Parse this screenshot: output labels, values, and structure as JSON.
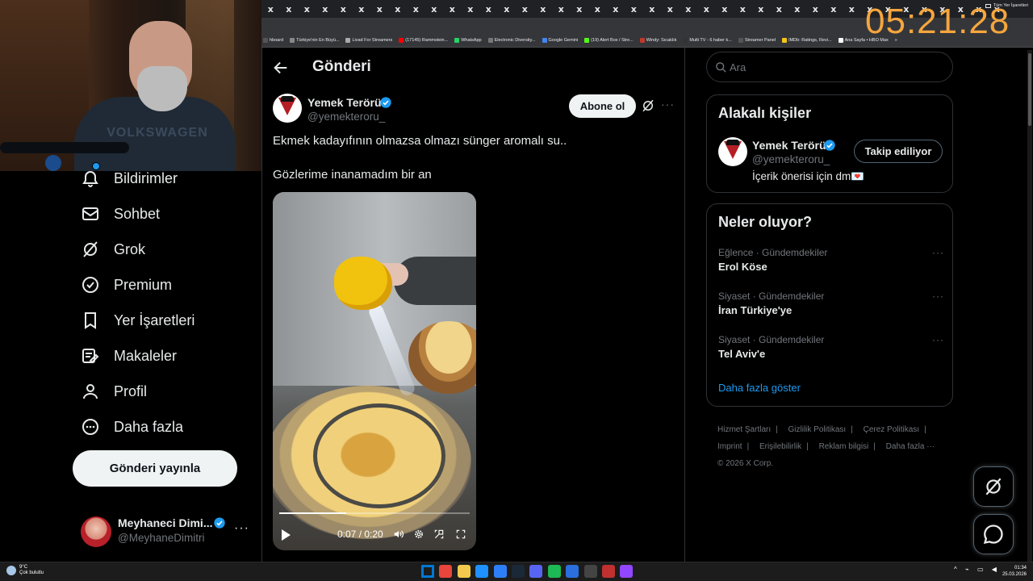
{
  "browser": {
    "tab_close_glyph": "x",
    "tab_count": 41,
    "bookmarks": [
      {
        "label": "hboard",
        "color": "#555"
      },
      {
        "label": "Türkiye'nin En Büyü...",
        "color": "#888"
      },
      {
        "label": "Livad For Streamers",
        "color": "#aaa"
      },
      {
        "label": "(17145) Rammstein...",
        "color": "#ff0000"
      },
      {
        "label": "WhatsApp",
        "color": "#25d366"
      },
      {
        "label": "Electronic Diversity...",
        "color": "#777"
      },
      {
        "label": "Google Gemini",
        "color": "#4285f4"
      },
      {
        "label": "(19) Alert Box / Stre...",
        "color": "#53fc18"
      },
      {
        "label": "Windy: Sıcaklık",
        "color": "#c0392b"
      },
      {
        "label": "Multi TV - 6 haber k...",
        "color": "#333"
      },
      {
        "label": "Streamer Panel",
        "color": "#555"
      },
      {
        "label": "IMDb: Ratings, Revi...",
        "color": "#f5c518"
      },
      {
        "label": "Ana Sayfa • HBO Max",
        "color": "#ffffff"
      }
    ],
    "bookmarks_overflow": "»",
    "all_bookmarks": "Tüm Yer İşaretleri"
  },
  "overlay": {
    "clock": "05:21:28",
    "webcam_shirt_text": "VOLKSWAGEN"
  },
  "nav": {
    "items": [
      {
        "label": "Bildirimler",
        "icon": "bell-icon"
      },
      {
        "label": "Sohbet",
        "icon": "mail-icon"
      },
      {
        "label": "Grok",
        "icon": "grok-icon"
      },
      {
        "label": "Premium",
        "icon": "verified-icon"
      },
      {
        "label": "Yer İşaretleri",
        "icon": "bookmark-icon"
      },
      {
        "label": "Makaleler",
        "icon": "articles-icon"
      },
      {
        "label": "Profil",
        "icon": "person-icon"
      },
      {
        "label": "Daha fazla",
        "icon": "more-circle-icon"
      }
    ],
    "post_button": "Gönderi yayınla",
    "account": {
      "name": "Meyhaneci Dimi...",
      "handle": "@MeyhaneDimitri",
      "more": "···"
    }
  },
  "post": {
    "header_title": "Gönderi",
    "author_name": "Yemek Terörü",
    "author_handle": "@yemekteroru_",
    "subscribe_label": "Abone ol",
    "more": "···",
    "text_line1": "Ekmek kadayıfının olmazsa olmazı sünger aromalı su..",
    "text_line2": "Gözlerime inanamadım bir an",
    "video": {
      "time": "0:07 / 0:20",
      "progress": 0.35
    }
  },
  "sidebar": {
    "search_placeholder": "Ara",
    "related": {
      "title": "Alakalı kişiler",
      "name": "Yemek Terörü",
      "handle": "@yemekteroru_",
      "bio": "İçerik önerisi için dm💌",
      "follow_label": "Takip ediliyor"
    },
    "trends": {
      "title": "Neler oluyor?",
      "items": [
        {
          "meta": "Eğlence · Gündemdekiler",
          "name": "Erol Köse"
        },
        {
          "meta": "Siyaset · Gündemdekiler",
          "name": "İran Türkiye'ye"
        },
        {
          "meta": "Siyaset · Gündemdekiler",
          "name": "Tel Aviv'e"
        }
      ],
      "show_more": "Daha fazla göster",
      "item_more": "···"
    },
    "footer": {
      "row1": [
        "Hizmet Şartları",
        "Gizlilik Politikası",
        "Çerez Politikası"
      ],
      "row2": [
        "Imprint",
        "Erişilebilirlik",
        "Reklam bilgisi",
        "Daha fazla ···"
      ],
      "copyright": "© 2026 X Corp.",
      "separator": "|"
    }
  },
  "taskbar": {
    "weather_temp": "9°C",
    "weather_desc": "Çok bulutlu",
    "tray_glyphs": "^ ⌁ ▭ ◀",
    "time": "01:34",
    "date": "25.03.2026",
    "app_colors": [
      "#0078d4",
      "#e8453c",
      "#f2c94c",
      "#1e90ff",
      "#2d7ff9",
      "#1b2838",
      "#5865f2",
      "#1db954",
      "#2a6fdb",
      "#444444",
      "#c03030",
      "#9146ff"
    ]
  },
  "colors": {
    "accent": "#1d9bf0",
    "clock": "#f5a63d",
    "verified": "#1d9bf0"
  }
}
